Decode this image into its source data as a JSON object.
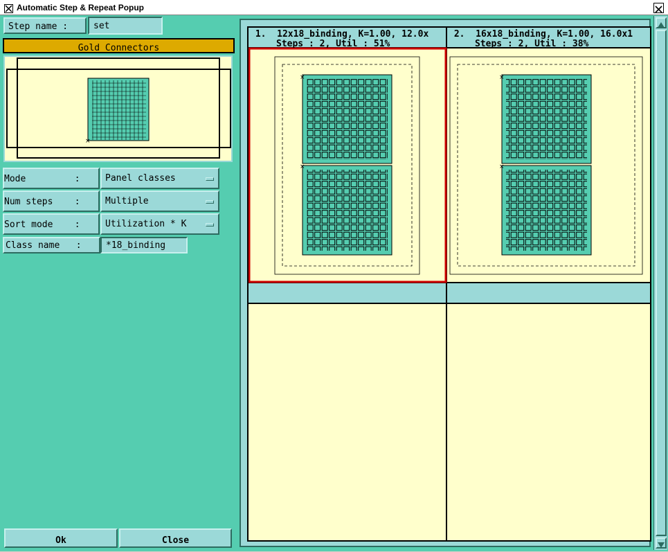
{
  "window": {
    "title": "Automatic Step & Repeat Popup"
  },
  "left": {
    "step_name_label": "Step name :",
    "step_name_value": "set",
    "section_header": "Gold Connectors",
    "fields": [
      {
        "label": "Mode         :",
        "value": "Panel classes"
      },
      {
        "label": "Num steps    :",
        "value": "Multiple"
      },
      {
        "label": "Sort mode    :",
        "value": "Utilization * K"
      }
    ],
    "class_name_label": "Class name   :",
    "class_name_value": "*18_binding",
    "ok_label": "Ok",
    "close_label": "Close"
  },
  "results": [
    {
      "line1": " 1.  12x18_binding, K=1.00, 12.0x",
      "line2": "Steps : 2, Util : 51%"
    },
    {
      "line1": " 2.  16x18_binding, K=1.00, 16.0x1",
      "line2": "Steps : 2, Util : 38%"
    }
  ],
  "colors": {
    "panel_bg": "#55cdb0",
    "field_bg": "#9bd9d8",
    "canvas_bg": "#ffffcc",
    "gold": "#ddaa00",
    "selected_border": "#cc0000"
  },
  "icons": {
    "app": "app-icon",
    "close": "close-icon",
    "scroll_up": "scroll-up-arrow-icon",
    "scroll_down": "scroll-down-arrow-icon",
    "dropdown": "dropdown-indicator-icon"
  }
}
